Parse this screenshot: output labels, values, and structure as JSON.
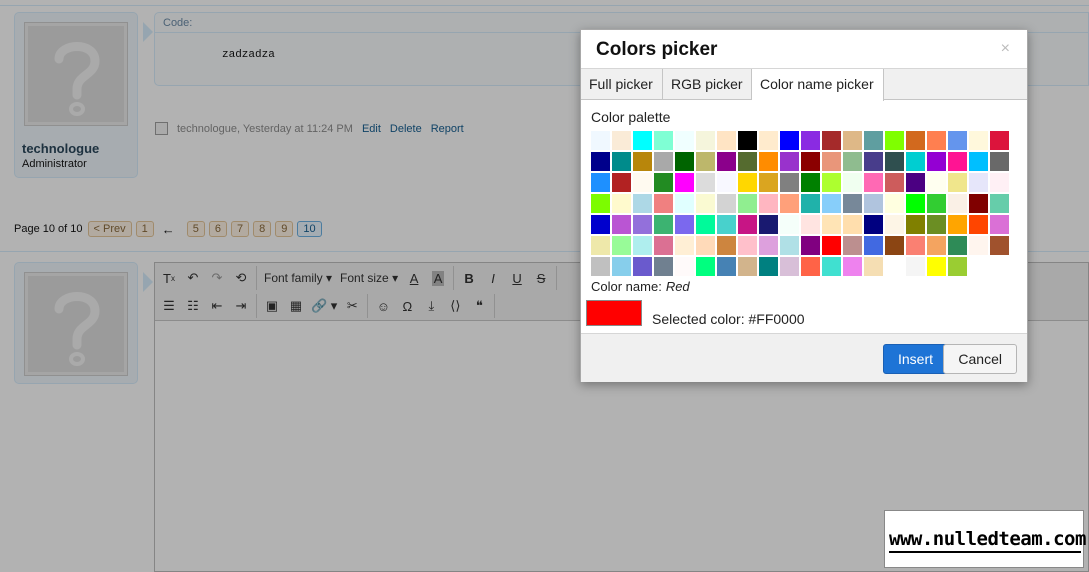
{
  "code_block": {
    "label": "Code:",
    "text": "zadzadza"
  },
  "post": {
    "username": "technologue",
    "user_title": "Administrator",
    "meta_text": "technologue, Yesterday at 11:24 PM",
    "actions": [
      "Edit",
      "Delete",
      "Report"
    ]
  },
  "pagination": {
    "summary": "Page 10 of 10",
    "prev": "< Prev",
    "first": "1",
    "jump_arrow": "←",
    "pages": [
      "5",
      "6",
      "7",
      "8",
      "9",
      "10"
    ],
    "current": "10"
  },
  "toolbar": {
    "font_family": "Font family",
    "font_size": "Font size"
  },
  "dialog": {
    "title": "Colors picker",
    "close": "×",
    "tabs": [
      "Full picker",
      "RGB picker",
      "Color name picker"
    ],
    "active_tab": "Color name picker",
    "palette_label": "Color palette",
    "color_name_label": "Color name:",
    "color_name_value": "Red",
    "selected_label": "Selected color: #FF0000",
    "selected_hex": "#FF0000",
    "insert": "Insert",
    "cancel": "Cancel",
    "palette": [
      [
        "#F0F8FF",
        "#FAEBD7",
        "#00FFFF",
        "#7FFFD4",
        "#F0FFFF",
        "#F5F5DC",
        "#FFE4C4",
        "#000000",
        "#FFEBCD",
        "#0000FF",
        "#8A2BE2",
        "#A52A2A",
        "#DEB887",
        "#5F9EA0",
        "#7FFF00",
        "#D2691E",
        "#FF7F50",
        "#6495ED",
        "#FFF8DC",
        "#DC143C"
      ],
      [
        "#00008B",
        "#008B8B",
        "#B8860B",
        "#A9A9A9",
        "#006400",
        "#BDB76B",
        "#8B008B",
        "#556B2F",
        "#FF8C00",
        "#9932CC",
        "#8B0000",
        "#E9967A",
        "#8FBC8F",
        "#483D8B",
        "#2F4F4F",
        "#00CED1",
        "#9400D3",
        "#FF1493",
        "#00BFFF",
        "#696969"
      ],
      [
        "#1E90FF",
        "#B22222",
        "#FFFAF0",
        "#228B22",
        "#FF00FF",
        "#DCDCDC",
        "#F8F8FF",
        "#FFD700",
        "#DAA520",
        "#808080",
        "#008000",
        "#ADFF2F",
        "#F0FFF0",
        "#FF69B4",
        "#CD5C5C",
        "#4B0082",
        "#FFFFF0",
        "#F0E68C",
        "#E6E6FA",
        "#FFF0F5"
      ],
      [
        "#7CFC00",
        "#FFFACD",
        "#ADD8E6",
        "#F08080",
        "#E0FFFF",
        "#FAFAD2",
        "#D3D3D3",
        "#90EE90",
        "#FFB6C1",
        "#FFA07A",
        "#20B2AA",
        "#87CEFA",
        "#778899",
        "#B0C4DE",
        "#FFFFE0",
        "#00FF00",
        "#32CD32",
        "#FAF0E6",
        "#800000",
        "#66CDAA"
      ],
      [
        "#0000CD",
        "#BA55D3",
        "#9370DB",
        "#3CB371",
        "#7B68EE",
        "#00FA9A",
        "#48D1CC",
        "#C71585",
        "#191970",
        "#F5FFFA",
        "#FFE4E1",
        "#FFE4B5",
        "#FFDEAD",
        "#000080",
        "#FDF5E6",
        "#808000",
        "#6B8E23",
        "#FFA500",
        "#FF4500",
        "#DA70D6"
      ],
      [
        "#EEE8AA",
        "#98FB98",
        "#AFEEEE",
        "#DB7093",
        "#FFEFD5",
        "#FFDAB9",
        "#CD853F",
        "#FFC0CB",
        "#DDA0DD",
        "#B0E0E6",
        "#800080",
        "#FF0000",
        "#BC8F8F",
        "#4169E1",
        "#8B4513",
        "#FA8072",
        "#F4A460",
        "#2E8B57",
        "#FFF5EE",
        "#A0522D"
      ],
      [
        "#C0C0C0",
        "#87CEEB",
        "#6A5ACD",
        "#708090",
        "#FFFAFA",
        "#00FF7F",
        "#4682B4",
        "#D2B48C",
        "#008080",
        "#D8BFD8",
        "#FF6347",
        "#40E0D0",
        "#EE82EE",
        "#F5DEB3",
        "#FFFFFF",
        "#F5F5F5",
        "#FFFF00",
        "#9ACD32"
      ]
    ]
  },
  "watermark": "www.nulledteam.com"
}
